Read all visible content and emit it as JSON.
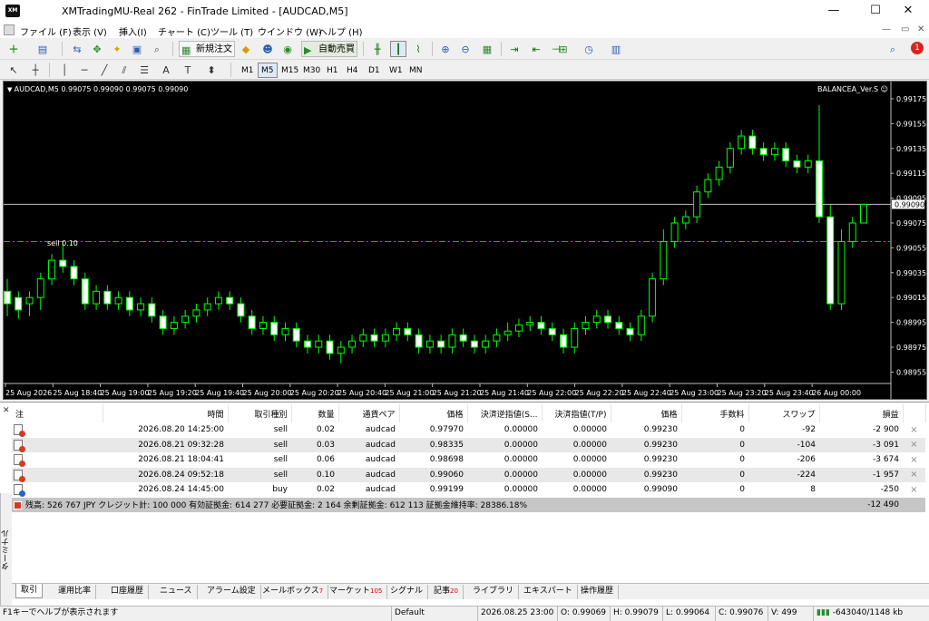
{
  "window": {
    "title": "XMTradingMU-Real 262 - FinTrade Limited - [AUDCAD,M5]",
    "icon_text": "XM",
    "minimize": "—",
    "maximize": "☐",
    "close": "✕"
  },
  "menu": {
    "items": [
      "ファイル (F)",
      "表示 (V)",
      "挿入(I)",
      "チャート (C)",
      "ツール (T)",
      "ウインドウ (W)",
      "ヘルプ (H)"
    ],
    "mdi": [
      "—",
      "▭",
      "✕"
    ]
  },
  "toolbar": {
    "new_order": "新規注文",
    "autotrading": "自動売買",
    "alert_count": "1"
  },
  "timeframes": [
    "M1",
    "M5",
    "M15",
    "M30",
    "H1",
    "H4",
    "D1",
    "W1",
    "MN"
  ],
  "active_timeframe": "M5",
  "chart": {
    "symbol_line": "AUDCAD,M5  0.99075 0.99090 0.99075 0.99090",
    "ea_name": "BALANCEA_Ver.S ☺",
    "sell_label": "sell 0.10",
    "current_price_label": "0.99090",
    "colors": {
      "background": "#000000",
      "up": "#00ff00",
      "down_fill": "#ffffff",
      "dashed_line": "#00c000",
      "price_line": "#c0c0c0"
    }
  },
  "chart_data": {
    "type": "candlestick",
    "title": "AUDCAD,M5",
    "y_ticks": [
      "0.99175",
      "0.99155",
      "0.99135",
      "0.99115",
      "0.99095",
      "0.99075",
      "0.99055",
      "0.99035",
      "0.99015",
      "0.98995",
      "0.98975",
      "0.98955"
    ],
    "x_ticks": [
      "25 Aug 2026",
      "25 Aug 18:40",
      "25 Aug 19:00",
      "25 Aug 19:20",
      "25 Aug 19:40",
      "25 Aug 20:00",
      "25 Aug 20:20",
      "25 Aug 20:40",
      "25 Aug 21:00",
      "25 Aug 21:20",
      "25 Aug 21:40",
      "25 Aug 22:00",
      "25 Aug 22:20",
      "25 Aug 22:40",
      "25 Aug 23:00",
      "25 Aug 23:20",
      "25 Aug 23:40",
      "26 Aug 00:00"
    ],
    "ylim": [
      0.98948,
      0.99183
    ],
    "current_price": 0.9909,
    "sell_order_price": 0.9906,
    "candles": [
      [
        0.9902,
        0.9901,
        0.9903,
        0.99
      ],
      [
        0.99015,
        0.99005,
        0.9902,
        0.98998
      ],
      [
        0.9901,
        0.99015,
        0.9902,
        0.99
      ],
      [
        0.99015,
        0.9903,
        0.99035,
        0.99005
      ],
      [
        0.9903,
        0.99045,
        0.9905,
        0.99025
      ],
      [
        0.99045,
        0.9904,
        0.9906,
        0.99035
      ],
      [
        0.9904,
        0.9903,
        0.99045,
        0.99025
      ],
      [
        0.9903,
        0.9901,
        0.99035,
        0.99005
      ],
      [
        0.9901,
        0.9902,
        0.99025,
        0.99005
      ],
      [
        0.9902,
        0.9901,
        0.99025,
        0.99005
      ],
      [
        0.9901,
        0.99015,
        0.9902,
        0.99005
      ],
      [
        0.99015,
        0.99005,
        0.9902,
        0.99
      ],
      [
        0.99005,
        0.9901,
        0.99015,
        0.99
      ],
      [
        0.9901,
        0.99,
        0.99015,
        0.98995
      ],
      [
        0.99,
        0.9899,
        0.99005,
        0.98985
      ],
      [
        0.9899,
        0.98995,
        0.99,
        0.98985
      ],
      [
        0.98995,
        0.99,
        0.99005,
        0.9899
      ],
      [
        0.99,
        0.99005,
        0.9901,
        0.98995
      ],
      [
        0.99005,
        0.9901,
        0.99015,
        0.99
      ],
      [
        0.9901,
        0.99015,
        0.9902,
        0.99005
      ],
      [
        0.99015,
        0.9901,
        0.9902,
        0.99005
      ],
      [
        0.9901,
        0.99,
        0.99015,
        0.98995
      ],
      [
        0.99,
        0.9899,
        0.99005,
        0.98985
      ],
      [
        0.9899,
        0.98995,
        0.99,
        0.98985
      ],
      [
        0.98995,
        0.98985,
        0.99,
        0.9898
      ],
      [
        0.98985,
        0.9899,
        0.98995,
        0.9898
      ],
      [
        0.9899,
        0.9898,
        0.98995,
        0.98975
      ],
      [
        0.9898,
        0.98975,
        0.98985,
        0.9897
      ],
      [
        0.98975,
        0.9898,
        0.98985,
        0.9897
      ],
      [
        0.9898,
        0.9897,
        0.98985,
        0.98965
      ],
      [
        0.9897,
        0.98975,
        0.9898,
        0.98962
      ],
      [
        0.98975,
        0.9898,
        0.98985,
        0.9897
      ],
      [
        0.9898,
        0.98985,
        0.9899,
        0.98975
      ],
      [
        0.98985,
        0.9898,
        0.9899,
        0.98975
      ],
      [
        0.9898,
        0.98985,
        0.9899,
        0.98975
      ],
      [
        0.98985,
        0.9899,
        0.98995,
        0.9898
      ],
      [
        0.9899,
        0.98985,
        0.98995,
        0.9898
      ],
      [
        0.98985,
        0.98975,
        0.9899,
        0.9897
      ],
      [
        0.98975,
        0.9898,
        0.98985,
        0.9897
      ],
      [
        0.9898,
        0.98975,
        0.98985,
        0.9897
      ],
      [
        0.98975,
        0.98985,
        0.9899,
        0.9897
      ],
      [
        0.98985,
        0.9898,
        0.9899,
        0.98975
      ],
      [
        0.9898,
        0.98975,
        0.98985,
        0.9897
      ],
      [
        0.98975,
        0.9898,
        0.98985,
        0.9897
      ],
      [
        0.9898,
        0.98985,
        0.9899,
        0.98975
      ],
      [
        0.98985,
        0.98988,
        0.98995,
        0.9898
      ],
      [
        0.98988,
        0.98993,
        0.98998,
        0.98983
      ],
      [
        0.98993,
        0.98995,
        0.99,
        0.98988
      ],
      [
        0.98995,
        0.9899,
        0.99,
        0.98985
      ],
      [
        0.9899,
        0.98985,
        0.98995,
        0.9898
      ],
      [
        0.98985,
        0.98975,
        0.9899,
        0.9897
      ],
      [
        0.98975,
        0.9899,
        0.98995,
        0.9897
      ],
      [
        0.9899,
        0.98995,
        0.99,
        0.98985
      ],
      [
        0.98995,
        0.99,
        0.99005,
        0.9899
      ],
      [
        0.99,
        0.98995,
        0.99005,
        0.9899
      ],
      [
        0.98995,
        0.9899,
        0.99,
        0.98985
      ],
      [
        0.9899,
        0.98985,
        0.98995,
        0.9898
      ],
      [
        0.98985,
        0.99,
        0.99005,
        0.9898
      ],
      [
        0.99,
        0.9903,
        0.99035,
        0.98995
      ],
      [
        0.9903,
        0.9906,
        0.9907,
        0.99025
      ],
      [
        0.9906,
        0.99075,
        0.9908,
        0.99055
      ],
      [
        0.99075,
        0.9908,
        0.99085,
        0.9907
      ],
      [
        0.9908,
        0.991,
        0.99105,
        0.99075
      ],
      [
        0.991,
        0.9911,
        0.99115,
        0.99095
      ],
      [
        0.9911,
        0.9912,
        0.99125,
        0.99105
      ],
      [
        0.9912,
        0.99135,
        0.9914,
        0.99115
      ],
      [
        0.99135,
        0.99145,
        0.9915,
        0.9913
      ],
      [
        0.99145,
        0.99135,
        0.9915,
        0.9913
      ],
      [
        0.99135,
        0.9913,
        0.9914,
        0.99125
      ],
      [
        0.9913,
        0.99135,
        0.9914,
        0.99125
      ],
      [
        0.99135,
        0.99125,
        0.9914,
        0.9912
      ],
      [
        0.99125,
        0.9912,
        0.9913,
        0.99115
      ],
      [
        0.9912,
        0.99125,
        0.9913,
        0.99115
      ],
      [
        0.99125,
        0.9908,
        0.9917,
        0.99075
      ],
      [
        0.9908,
        0.9901,
        0.9909,
        0.99005
      ],
      [
        0.9901,
        0.9906,
        0.9907,
        0.99005
      ],
      [
        0.9906,
        0.99075,
        0.9908,
        0.99055
      ],
      [
        0.99075,
        0.9909,
        0.9909,
        0.99075
      ]
    ]
  },
  "trade_table": {
    "headers": [
      "注",
      "時間",
      "取引種別",
      "数量",
      "通貨ペア",
      "価格",
      "決済逆指値(S...",
      "決済指値(T/P)",
      "価格",
      "手数料",
      "スワップ",
      "損益"
    ],
    "rows": [
      {
        "type": "sell",
        "time": "2026.08.20 14:25:00",
        "kind": "sell",
        "volume": "0.02",
        "symbol": "audcad",
        "price": "0.97970",
        "sl": "0.00000",
        "tp": "0.00000",
        "current": "0.99230",
        "commission": "0",
        "swap": "-92",
        "profit": "-2 900"
      },
      {
        "type": "sell",
        "time": "2026.08.21 09:32:28",
        "kind": "sell",
        "volume": "0.03",
        "symbol": "audcad",
        "price": "0.98335",
        "sl": "0.00000",
        "tp": "0.00000",
        "current": "0.99230",
        "commission": "0",
        "swap": "-104",
        "profit": "-3 091"
      },
      {
        "type": "sell",
        "time": "2026.08.21 18:04:41",
        "kind": "sell",
        "volume": "0.06",
        "symbol": "audcad",
        "price": "0.98698",
        "sl": "0.00000",
        "tp": "0.00000",
        "current": "0.99230",
        "commission": "0",
        "swap": "-206",
        "profit": "-3 674"
      },
      {
        "type": "sell",
        "time": "2026.08.24 09:52:18",
        "kind": "sell",
        "volume": "0.10",
        "symbol": "audcad",
        "price": "0.99060",
        "sl": "0.00000",
        "tp": "0.00000",
        "current": "0.99230",
        "commission": "0",
        "swap": "-224",
        "profit": "-1 957"
      },
      {
        "type": "buy",
        "time": "2026.08.24 14:45:00",
        "kind": "buy",
        "volume": "0.02",
        "symbol": "audcad",
        "price": "0.99199",
        "sl": "0.00000",
        "tp": "0.00000",
        "current": "0.99090",
        "commission": "0",
        "swap": "8",
        "profit": "-250"
      }
    ],
    "summary": "残高: 526 767 JPY  クレジット計: 100 000  有効証拠金: 614 277  必要証拠金: 2 164  余剰証拠金: 612 113  証拠金維持率: 28386.18%",
    "summary_profit": "-12 490"
  },
  "terminal_side_label": "ターミナル",
  "tabs": [
    {
      "label": "取引",
      "badge": ""
    },
    {
      "label": "運用比率",
      "badge": ""
    },
    {
      "label": "口座履歴",
      "badge": ""
    },
    {
      "label": "ニュース",
      "badge": ""
    },
    {
      "label": "アラーム設定",
      "badge": ""
    },
    {
      "label": "メールボックス",
      "badge": "7"
    },
    {
      "label": "マーケット",
      "badge": "105"
    },
    {
      "label": "シグナル",
      "badge": ""
    },
    {
      "label": "記事",
      "badge": "20"
    },
    {
      "label": "ライブラリ",
      "badge": ""
    },
    {
      "label": "エキスパート",
      "badge": ""
    },
    {
      "label": "操作履歴",
      "badge": ""
    }
  ],
  "status": {
    "help": "F1キーでヘルプが表示されます",
    "profile": "Default",
    "datetime": "2026.08.25 23:00",
    "open": "O: 0.99069",
    "high": "H: 0.99079",
    "low": "L: 0.99064",
    "close": "C: 0.99076",
    "volume": "V: 499",
    "traffic": "-643040/1148 kb"
  }
}
